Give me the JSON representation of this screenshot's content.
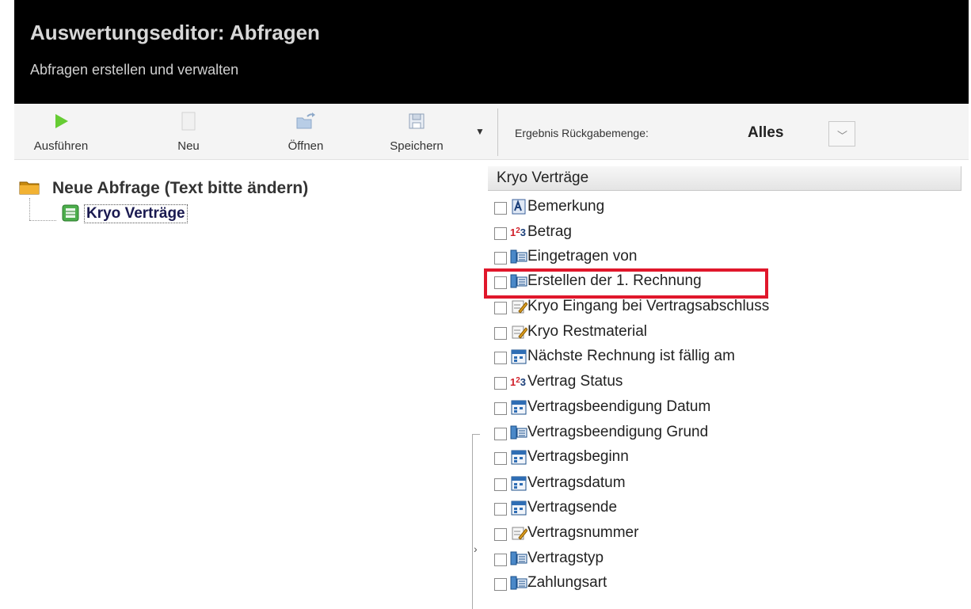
{
  "header": {
    "title": "Auswertungseditor: Abfragen",
    "subtitle": "Abfragen erstellen und verwalten"
  },
  "toolbar": {
    "run_label": "Ausführen",
    "new_label": "Neu",
    "open_label": "Öffnen",
    "save_label": "Speichern",
    "dropdown_glyph": "▼",
    "result_label": "Ergebnis Rückgabemenge:",
    "result_value": "Alles",
    "select_glyph": "﹀"
  },
  "tree": {
    "root_label": "Neue Abfrage (Text bitte ändern)",
    "child_label": "Kryo Verträge"
  },
  "fields": {
    "header": "Kryo Verträge",
    "items": [
      {
        "label": "Bemerkung",
        "icon": "memo-field-icon"
      },
      {
        "label": "Betrag",
        "icon": "number-field-icon"
      },
      {
        "label": "Eingetragen von",
        "icon": "lookup-field-icon"
      },
      {
        "label": "Erstellen der 1. Rechnung",
        "icon": "lookup-field-icon",
        "highlighted": true
      },
      {
        "label": "Kryo Eingang bei Vertragsabschluss",
        "icon": "text-field-icon"
      },
      {
        "label": "Kryo Restmaterial",
        "icon": "text-field-icon"
      },
      {
        "label": "Nächste Rechnung ist fällig am",
        "icon": "date-field-icon"
      },
      {
        "label": "Vertrag Status",
        "icon": "number-field-icon"
      },
      {
        "label": "Vertragsbeendigung Datum",
        "icon": "date-field-icon"
      },
      {
        "label": "Vertragsbeendigung Grund",
        "icon": "lookup-field-icon"
      },
      {
        "label": "Vertragsbeginn",
        "icon": "date-field-icon"
      },
      {
        "label": "Vertragsdatum",
        "icon": "date-field-icon"
      },
      {
        "label": "Vertragsende",
        "icon": "date-field-icon"
      },
      {
        "label": "Vertragsnummer",
        "icon": "text-field-icon"
      },
      {
        "label": "Vertragstyp",
        "icon": "lookup-field-icon"
      },
      {
        "label": "Zahlungsart",
        "icon": "lookup-field-icon"
      }
    ]
  },
  "splitter": {
    "glyph": "›"
  },
  "colors": {
    "header_bg": "#000000",
    "highlight": "#e0172b",
    "run_icon": "#66cc33"
  }
}
